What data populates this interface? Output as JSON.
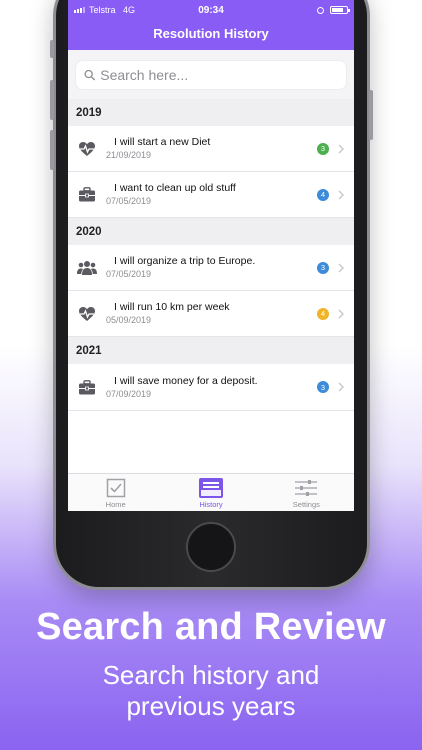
{
  "status_bar": {
    "carrier": "Telstra",
    "network": "4G",
    "time": "09:34"
  },
  "nav": {
    "title": "Resolution History"
  },
  "search": {
    "placeholder": "Search here..."
  },
  "sections": [
    {
      "year": "2019",
      "items": [
        {
          "icon": "heartbeat-icon",
          "title": "I will start a new Diet",
          "date": "21/09/2019",
          "badge": "3",
          "badge_color": "#4caf50"
        },
        {
          "icon": "briefcase-icon",
          "title": "I want to clean up old stuff",
          "date": "07/05/2019",
          "badge": "4",
          "badge_color": "#3d8bd9"
        }
      ]
    },
    {
      "year": "2020",
      "items": [
        {
          "icon": "people-icon",
          "title": "I will organize a trip to Europe.",
          "date": "07/05/2019",
          "badge": "3",
          "badge_color": "#3d8bd9"
        },
        {
          "icon": "heartbeat-icon",
          "title": "I will run 10 km per week",
          "date": "05/09/2019",
          "badge": "4",
          "badge_color": "#f0b429"
        }
      ]
    },
    {
      "year": "2021",
      "items": [
        {
          "icon": "briefcase-icon",
          "title": "I will save money for a deposit.",
          "date": "07/09/2019",
          "badge": "3",
          "badge_color": "#3d8bd9"
        }
      ]
    }
  ],
  "tabs": [
    {
      "label": "Home",
      "icon": "checkbox-icon",
      "active": false
    },
    {
      "label": "History",
      "icon": "inbox-icon",
      "active": true
    },
    {
      "label": "Settings",
      "icon": "sliders-icon",
      "active": false
    }
  ],
  "caption": {
    "headline": "Search and Review",
    "subline": "Search history and previous years"
  },
  "colors": {
    "accent": "#8a5cf6",
    "tab_active": "#7b56e8"
  }
}
